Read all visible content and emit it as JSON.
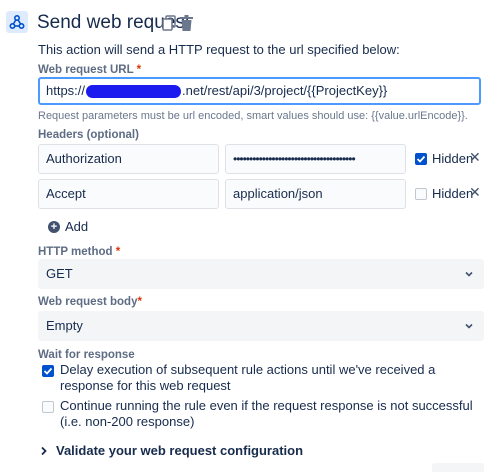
{
  "header": {
    "title": "Send web request",
    "description": "This action will send a HTTP request to the url specified below:"
  },
  "url": {
    "label": "Web request URL",
    "required_mark": "*",
    "value_prefix": "https://",
    "value_suffix": ".net/rest/api/3/project/{{ProjectKey}}",
    "helper": "Request parameters must be url encoded, smart values should use: {{value.urlEncode}}."
  },
  "headers": {
    "label": "Headers (optional)",
    "rows": [
      {
        "name": "Authorization",
        "value": "••••••••••••••••••••••••••••••••••••••",
        "hidden": true,
        "hidden_label": "Hidden",
        "remove": "✕"
      },
      {
        "name": "Accept",
        "value": "application/json",
        "hidden": false,
        "hidden_label": "Hidden",
        "remove": "✕"
      }
    ],
    "add_label": "Add"
  },
  "method": {
    "label": "HTTP method",
    "required_mark": "*",
    "value": "GET"
  },
  "body": {
    "label": "Web request body",
    "required_mark": "*",
    "value": "Empty"
  },
  "wait": {
    "label": "Wait for response",
    "options": [
      {
        "checked": true,
        "text": "Delay execution of subsequent rule actions until we've received a response for this web request"
      },
      {
        "checked": false,
        "text": "Continue running the rule even if the request response is not successful (i.e. non-200 response)"
      }
    ]
  },
  "validate": {
    "label": "Validate your web request configuration"
  },
  "icons": {
    "app": "webhook-icon",
    "copy": "copy-icon",
    "delete": "trash-icon",
    "check": "check-icon",
    "remove": "close-icon",
    "add": "plus-circle-icon",
    "dropdown": "chevron-down-icon",
    "expand": "chevron-right-icon"
  },
  "colors": {
    "accent": "#0052cc",
    "focus_border": "#4c9aff",
    "required": "#de350b",
    "redaction": "#1b1bf0"
  }
}
